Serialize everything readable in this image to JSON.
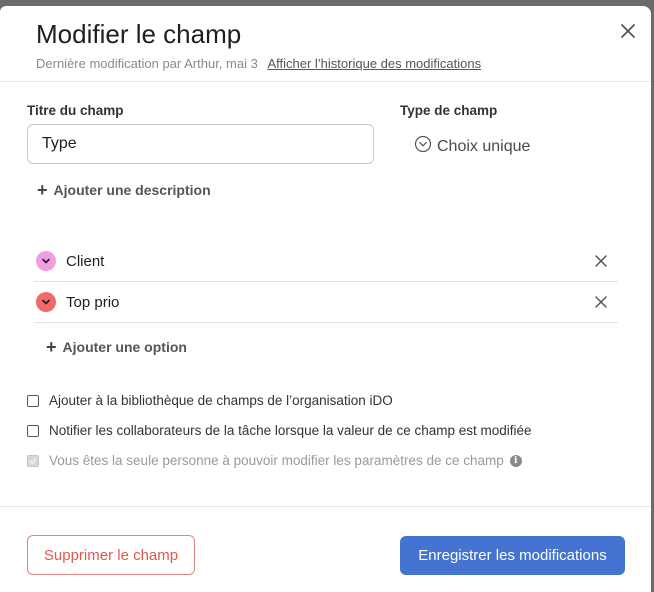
{
  "dialog": {
    "title": "Modifier le champ",
    "subtitle": "Dernière modification par Arthur, mai 3",
    "history_link": "Afficher l’historique des modifications"
  },
  "field": {
    "title_label": "Titre du champ",
    "title_value": "Type",
    "type_label": "Type de champ",
    "type_value": "Choix unique",
    "add_description": "Ajouter une description"
  },
  "options": {
    "items": [
      {
        "label": "Client",
        "color": "#f09ee0"
      },
      {
        "label": "Top prio",
        "color": "#f06a6a"
      }
    ],
    "add_option": "Ajouter une option"
  },
  "checkboxes": {
    "library": "Ajouter à la bibliothèque de champs de l’organisation iDO",
    "notify": "Notifier les collaborateurs de la tâche lorsque la valeur de ce champ est modifiée",
    "only_you": "Vous êtes la seule personne à pouvoir modifier les paramètres de ce champ"
  },
  "footer": {
    "delete_label": "Supprimer le champ",
    "save_label": "Enregistrer les modifications"
  },
  "icons": {
    "close": "close-icon",
    "type": "chevron-circle-icon",
    "add": "plus-icon",
    "option_chevron": "chevron-down-icon",
    "remove": "close-icon",
    "info": "info-icon"
  }
}
